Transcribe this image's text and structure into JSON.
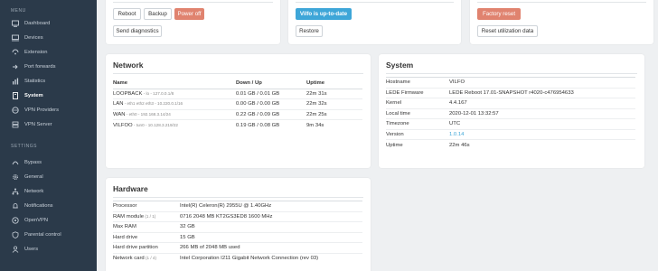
{
  "sidebar": {
    "menu_label": "MENU",
    "settings_label": "SETTINGS",
    "menu_items": [
      {
        "label": "Dashboard",
        "icon": "dashboard-icon"
      },
      {
        "label": "Devices",
        "icon": "devices-icon"
      },
      {
        "label": "Extension",
        "icon": "extension-icon"
      },
      {
        "label": "Port forwards",
        "icon": "port-forward-icon"
      },
      {
        "label": "Statistics",
        "icon": "statistics-icon"
      },
      {
        "label": "System",
        "icon": "system-icon",
        "active": true
      },
      {
        "label": "VPN Providers",
        "icon": "vpn-providers-icon"
      },
      {
        "label": "VPN Server",
        "icon": "vpn-server-icon"
      }
    ],
    "settings_items": [
      {
        "label": "Bypass",
        "icon": "bypass-icon"
      },
      {
        "label": "General",
        "icon": "gear-icon"
      },
      {
        "label": "Network",
        "icon": "network-icon"
      },
      {
        "label": "Notifications",
        "icon": "bell-icon"
      },
      {
        "label": "OpenVPN",
        "icon": "openvpn-icon"
      },
      {
        "label": "Parental control",
        "icon": "parental-icon"
      },
      {
        "label": "Users",
        "icon": "users-icon"
      }
    ]
  },
  "actions": {
    "reboot": "Reboot",
    "backup": "Backup",
    "power_off": "Power off",
    "send_diagnostics": "Send diagnostics",
    "update_status": "Vilfo is up-to-date",
    "restore": "Restore",
    "factory_reset": "Factory reset",
    "reset_utilization": "Reset utilization data"
  },
  "network": {
    "title": "Network",
    "headers": [
      "Name",
      "Down / Up",
      "Uptime"
    ],
    "rows": [
      {
        "name": "LOOPBACK",
        "detail": " - lo - 127.0.0.1/8",
        "traffic": "0.01 GB / 0.01 GB",
        "uptime": "22m 31s"
      },
      {
        "name": "LAN",
        "detail": " - eth1 eth2 eth3 - 10.220.0.1/16",
        "traffic": "0.00 GB / 0.00 GB",
        "uptime": "22m 32s"
      },
      {
        "name": "WAN",
        "detail": " - eth0 - 192.168.3.14/24",
        "traffic": "0.22 GB / 0.09 GB",
        "uptime": "22m 25s"
      },
      {
        "name": "VILFOO",
        "detail": " - tun0 - 10.128.3.219/22",
        "traffic": "0.19 GB / 0.08 GB",
        "uptime": "9m 34s"
      }
    ]
  },
  "system": {
    "title": "System",
    "rows": [
      {
        "label": "Hostname",
        "value": "VILFO"
      },
      {
        "label": "LEDE Firmware",
        "value": "LEDE Reboot 17.01-SNAPSHOT r4020-c476954633"
      },
      {
        "label": "Kernel",
        "value": "4.4.167"
      },
      {
        "label": "Local time",
        "value": "2020-12-01 13:32:57"
      },
      {
        "label": "Timezone",
        "value": "UTC"
      },
      {
        "label": "Version",
        "value": "1.0.14",
        "link": true
      },
      {
        "label": "Uptime",
        "value": "22m 46s"
      }
    ]
  },
  "hardware": {
    "title": "Hardware",
    "rows": [
      {
        "label": "Processor",
        "value": "Intel(R) Celeron(R) 2955U @ 1.40GHz"
      },
      {
        "label": "RAM module",
        "sub": " (1 / 1)",
        "value": "0716 2048 MB KT2GS3ED8 1600 MHz"
      },
      {
        "label": "Max RAM",
        "value": "32 GB"
      },
      {
        "label": "Hard drive",
        "value": "15 GB"
      },
      {
        "label": "Hard drive partition",
        "value": "266 MB of 2048 MB used"
      },
      {
        "label": "Network card",
        "sub": " (1 / 4)",
        "value": "Intel Corporation I211 Gigabit Network Connection (rev 03)"
      }
    ]
  },
  "colors": {
    "sidebar_bg": "#2b3a4a",
    "danger": "#e0836f",
    "info": "#3ea6d8",
    "page_bg": "#eef0f2"
  }
}
